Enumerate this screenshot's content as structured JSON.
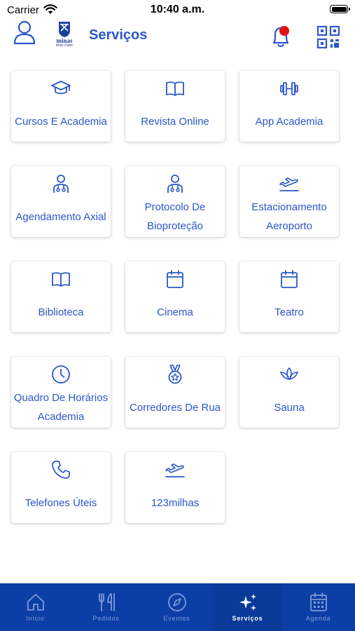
{
  "status_bar": {
    "carrier": "Carrier",
    "time": "10:40 a.m."
  },
  "header": {
    "title": "Serviços",
    "logo_name": "minas",
    "logo_sub": "tênis clube",
    "notification_dot_color": "#e01414"
  },
  "services": [
    {
      "label": "Cursos E Academia",
      "icon": "graduation-cap-icon"
    },
    {
      "label": "Revista Online",
      "icon": "book-icon"
    },
    {
      "label": "App Academia",
      "icon": "dumbbell-icon"
    },
    {
      "label": "Agendamento Axial",
      "icon": "doctor-icon"
    },
    {
      "label": "Protocolo De Bioproteção",
      "icon": "doctor-icon"
    },
    {
      "label": "Estacionamento Aeroporto",
      "icon": "airplane-icon"
    },
    {
      "label": "Biblioteca",
      "icon": "book-icon"
    },
    {
      "label": "Cinema",
      "icon": "calendar-icon"
    },
    {
      "label": "Teatro",
      "icon": "calendar-icon"
    },
    {
      "label": "Quadro De Horários Academia",
      "icon": "clock-icon"
    },
    {
      "label": "Corredores De Rua",
      "icon": "medal-icon"
    },
    {
      "label": "Sauna",
      "icon": "lotus-icon"
    },
    {
      "label": "Telefones Úteis",
      "icon": "phone-icon"
    },
    {
      "label": "123milhas",
      "icon": "airplane-icon"
    }
  ],
  "bottom_nav": [
    {
      "label": "Início",
      "icon": "home-icon",
      "active": false
    },
    {
      "label": "Pedidos",
      "icon": "utensils-icon",
      "active": false
    },
    {
      "label": "Eventos",
      "icon": "compass-icon",
      "active": false
    },
    {
      "label": "Serviços",
      "icon": "sparkles-icon",
      "active": true
    },
    {
      "label": "Agenda",
      "icon": "calendar-grid-icon",
      "active": false
    }
  ],
  "colors": {
    "accent": "#2a57c9",
    "nav_background": "#0b3fa6",
    "nav_inactive": "#7f9bd6",
    "nav_active": "#ffffff"
  }
}
